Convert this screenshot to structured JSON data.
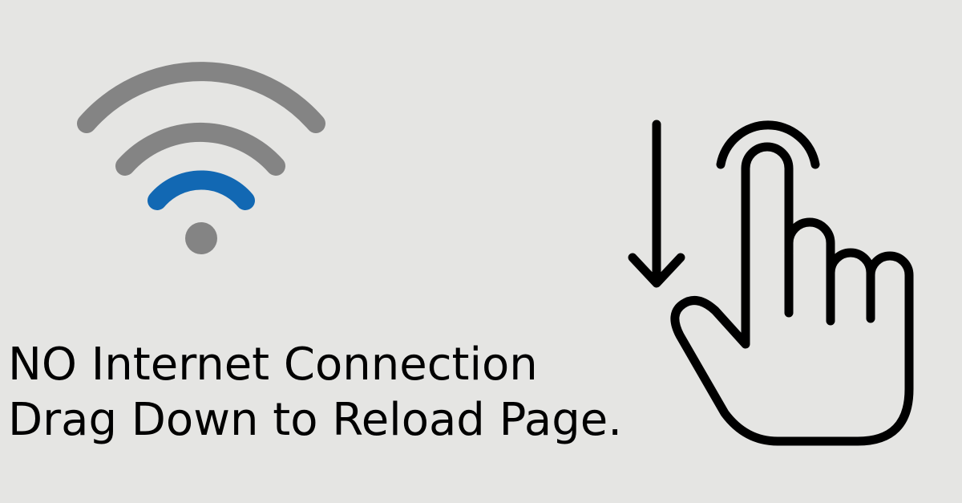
{
  "colors": {
    "background": "#e5e5e3",
    "wifi_outer": "#848484",
    "wifi_inner": "#1268b3",
    "text": "#000000",
    "gesture_stroke": "#000000"
  },
  "wifi_icon": {
    "name": "wifi-weak-signal-icon",
    "active_bars": 1,
    "total_bars": 3
  },
  "message": {
    "line1": "NO Internet Connection",
    "line2": "Drag Down to Reload Page."
  },
  "gesture_icon": {
    "name": "swipe-down-hand-icon"
  }
}
